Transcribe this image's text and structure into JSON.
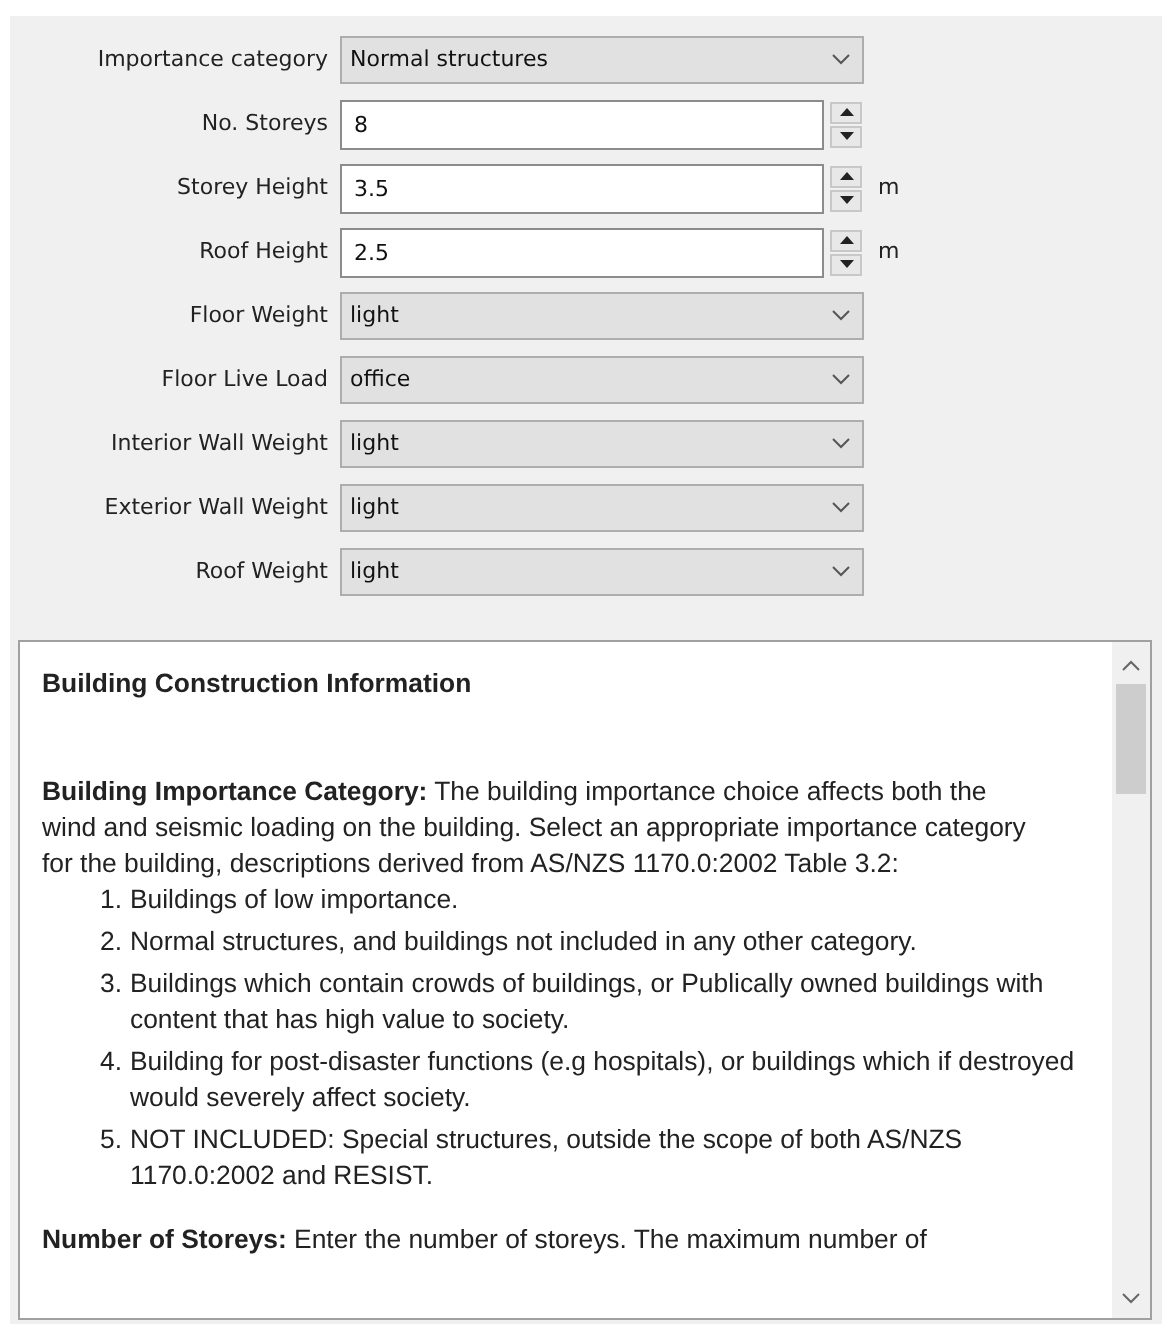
{
  "form": {
    "fields": [
      {
        "kind": "select",
        "label": "Importance category",
        "value": "Normal structures"
      },
      {
        "kind": "spin",
        "label": "No. Storeys",
        "value": "8"
      },
      {
        "kind": "spin",
        "label": "Storey Height",
        "value": "3.5",
        "unit": "m"
      },
      {
        "kind": "spin",
        "label": "Roof Height",
        "value": "2.5",
        "unit": "m"
      },
      {
        "kind": "select",
        "label": "Floor Weight",
        "value": "light"
      },
      {
        "kind": "select",
        "label": "Floor Live Load",
        "value": "office"
      },
      {
        "kind": "select",
        "label": "Interior Wall Weight",
        "value": "light"
      },
      {
        "kind": "select",
        "label": "Exterior Wall Weight",
        "value": "light"
      },
      {
        "kind": "select",
        "label": "Roof Weight",
        "value": "light"
      }
    ]
  },
  "info": {
    "title": "Building Construction Information",
    "sections": [
      {
        "text": "**Building Importance Category:** The building importance choice affects both the wind and seismic loading on the building. Select an appropriate importance category for the building, descriptions derived from AS/NZS 1170.0:2002 Table 3.2:",
        "items": [
          {
            "number": "1.",
            "text": "Buildings of low importance."
          },
          {
            "number": "2.",
            "text": "Normal structures, and buildings not included in any other category."
          },
          {
            "number": "3.",
            "text": "Buildings which contain crowds of buildings, or Publically owned buildings with content that has high value to society."
          },
          {
            "number": "4.",
            "text": "Building for post-disaster functions (e.g hospitals), or buildings which if destroyed would severely affect society."
          },
          {
            "number": "5.",
            "text": "NOT INCLUDED: Special structures, outside the scope of both AS/NZS 1170.0:2002 and RESIST."
          }
        ]
      },
      {
        "text": "**Number of Storeys:** Enter the number of storeys. The maximum number of"
      }
    ]
  }
}
